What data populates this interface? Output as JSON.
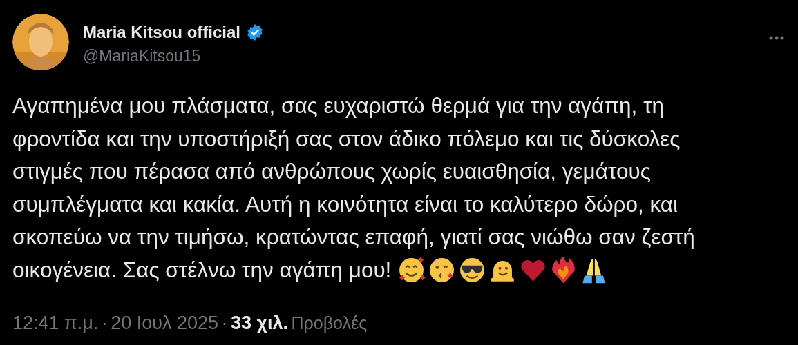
{
  "author": {
    "name": "Maria Kitsou official",
    "verified": true,
    "handle": "@MariaKitsou15"
  },
  "tweet": {
    "lines": [
      "Αγαπημένα μου πλάσματα, σας ευχαριστώ θερμά για την αγάπη, τη",
      "φροντίδα και την υποστήριξή σας στον άδικο πόλεμο και τις δύσκολες",
      "στιγμές που πέρασα από ανθρώπους χωρίς ευαισθησία, γεμάτους",
      "συμπλέγματα και κακία. Αυτή η κοινότητα είναι το καλύτερο δώρο, και",
      "σκοπεύω να την τιμήσω, κρατώντας επαφή, γιατί σας νιώθω σαν ζεστή",
      "οικογένεια. Σας στέλνω την αγάπη μου!"
    ],
    "emojis": [
      {
        "kind": "hearts-face"
      },
      {
        "kind": "kiss-face"
      },
      {
        "kind": "sunglasses-face"
      },
      {
        "kind": "melting-face"
      },
      {
        "kind": "heart"
      },
      {
        "kind": "fire-heart"
      },
      {
        "kind": "hands"
      }
    ]
  },
  "meta": {
    "time": "12:41 π.μ.",
    "separator_1": "·",
    "date": "20 Ιουλ 2025",
    "separator_2": "·",
    "views": "33 χιλ.",
    "views_label": "Προβολές"
  }
}
